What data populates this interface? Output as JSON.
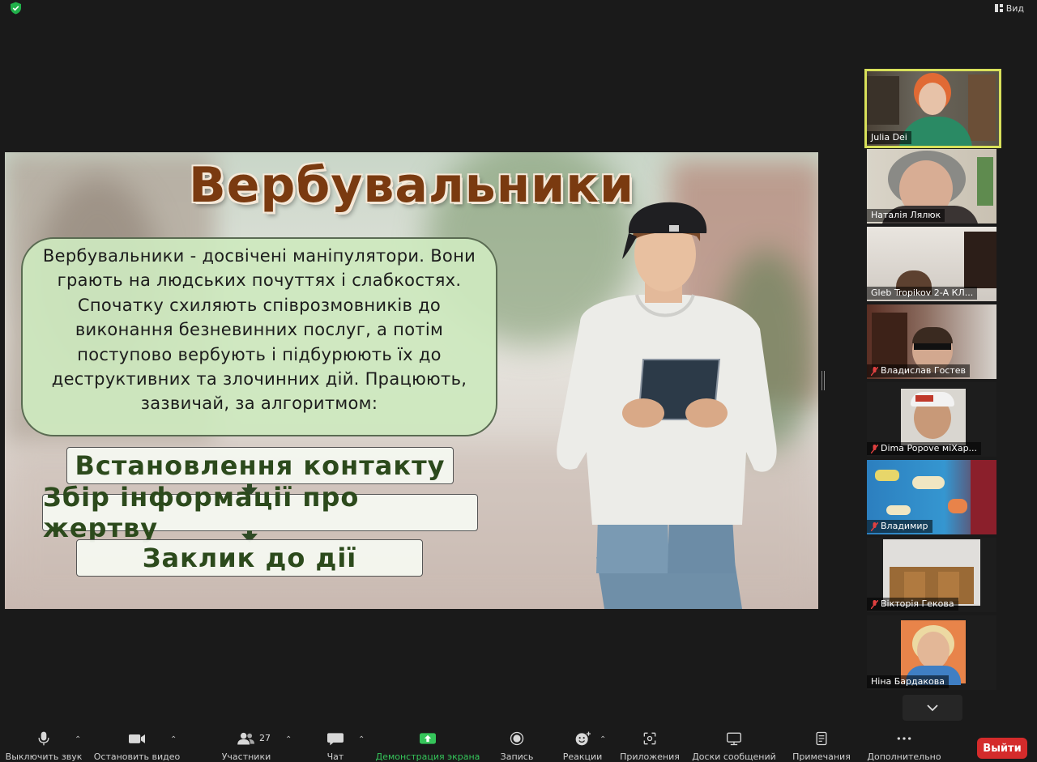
{
  "window": {
    "view_label": "Вид"
  },
  "slide": {
    "title": "Вербувальники",
    "description": "Вербувальники - досвічені маніпулятори. Вони грають на людських почуттях і слабкостях. Спочатку схиляють співрозмовників до виконання безневинних послуг, а потім поступово вербують і підбурюють їх до деструктивних та злочинних дій. Працюють, зазвичай, за алгоритмом:",
    "steps": [
      "Встановлення контакту",
      "Збір інформації про жертву",
      "Заклик до дії"
    ]
  },
  "participants": [
    {
      "name": "Julia Dei",
      "muted": false,
      "active": true
    },
    {
      "name": "Наталія Лялюк",
      "muted": false,
      "active": false
    },
    {
      "name": "Gleb Tropikov  2-А    КЛ...",
      "muted": false,
      "active": false
    },
    {
      "name": "Владислав Гостев",
      "muted": true,
      "active": false
    },
    {
      "name": "Dima Popove  міХар...",
      "muted": true,
      "active": false
    },
    {
      "name": "Владимир",
      "muted": true,
      "active": false
    },
    {
      "name": "Вікторія Гекова",
      "muted": true,
      "active": false
    },
    {
      "name": "Ніна Бардакова",
      "muted": false,
      "active": false
    }
  ],
  "toolbar": {
    "mute": "Выключить звук",
    "stop_video": "Остановить видео",
    "participants": "Участники",
    "participants_count": "27",
    "chat": "Чат",
    "share_screen": "Демонстрация экрана",
    "record": "Запись",
    "reactions": "Реакции",
    "apps": "Приложения",
    "whiteboards": "Доски сообщений",
    "notes": "Примечания",
    "more": "Дополнительно",
    "leave": "Выйти"
  },
  "colors": {
    "background": "#1a1a1a",
    "active_speaker": "#d8e05a",
    "share_green": "#35c45a",
    "leave_red": "#d42b2b",
    "slide_title": "#7a3a10",
    "step_text": "#2c4a1c"
  }
}
